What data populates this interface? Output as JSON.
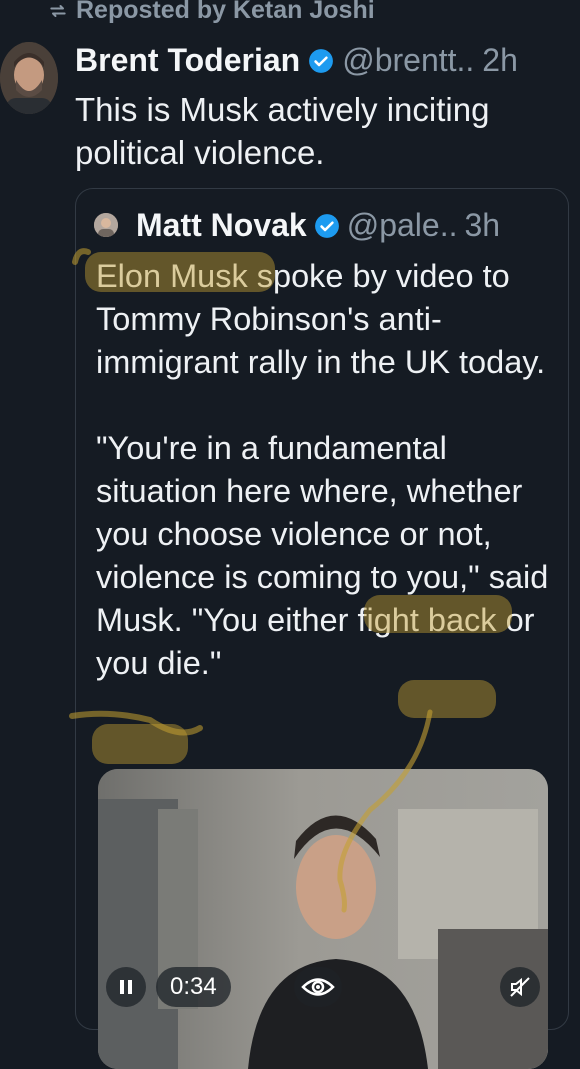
{
  "repost": {
    "text": "Reposted by Ketan Joshi",
    "icon": "repost-icon"
  },
  "post": {
    "author_name": "Brent Toderian",
    "handle": "@brentt..",
    "time": "2h",
    "text": "This is Musk actively inciting political violence."
  },
  "quote": {
    "author_name": "Matt Novak",
    "handle": "@pale..",
    "time": "3h",
    "paragraph1": "Elon Musk spoke by video to Tommy Robinson's anti-immigrant rally in the UK today.",
    "paragraph2": "\"You're in a fundamental situation here where, whether you choose violence or not, violence is coming to you,\" said Musk. \"You either fight back or you die.\""
  },
  "video": {
    "elapsed": "0:34",
    "icons": [
      "pause-icon",
      "eye-icon",
      "mute-icon"
    ]
  },
  "colors": {
    "background": "#151b23",
    "text": "#eef1f4",
    "muted": "#8b98a5",
    "verified": "#1d9bf0",
    "highlight": "#c4a032"
  }
}
